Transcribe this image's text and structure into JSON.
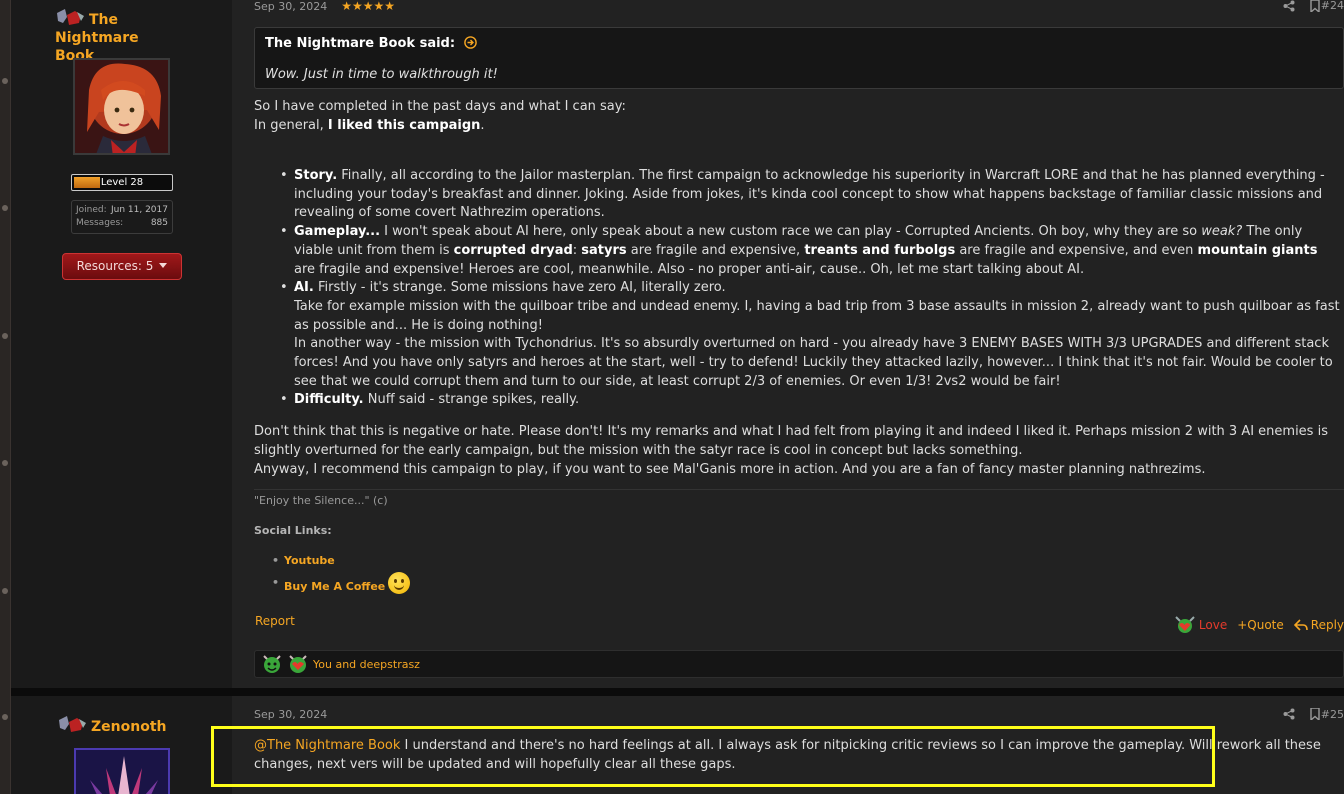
{
  "post1": {
    "author": "The Nightmare Book",
    "author_line1": "The Nightmare",
    "author_line2": "Book",
    "level": "Level 28",
    "joined_label": "Joined:",
    "joined_value": "Jun 11, 2017",
    "messages_label": "Messages:",
    "messages_value": "885",
    "resources_label": "Resources: 5",
    "date": "Sep 30, 2024",
    "rating": "★★★★★",
    "post_number": "#24",
    "quote_header": "The Nightmare Book said:",
    "quote_body": "Wow. Just in time to walkthrough it!",
    "intro_line1": "So I have completed in the past days and what I can say:",
    "intro_line2_pre": "In general, ",
    "intro_line2_bold": "I liked this campaign",
    "intro_line2_post": ".",
    "bullets": {
      "story_title": "Story.",
      "story_text": " Finally, all according to the Jailor masterplan. The first campaign to acknowledge his superiority in Warcraft LORE and that he has planned everything - including your today's breakfast and dinner. Joking. Aside from jokes, it's kinda cool concept to show what happens backstage of familiar classic missions and revealing of some covert Nathrezim operations.",
      "gameplay_title": "Gameplay...",
      "gameplay_text1": " I won't speak about AI here, only speak about a new custom race we can play - Corrupted Ancients. Oh boy, why they are so ",
      "gameplay_weak": "weak?",
      "gameplay_text2": " The only viable unit from them is ",
      "gameplay_dryad": "corrupted dryad",
      "gameplay_colon": ": ",
      "gameplay_satyrs": "satyrs",
      "gameplay_text3": " are fragile and expensive, ",
      "gameplay_treants": "treants and furbolgs",
      "gameplay_text4": " are fragile and expensive, and even ",
      "gameplay_giants": "mountain giants",
      "gameplay_text5": " are fragile and expensive! Heroes are cool, meanwhile. Also - no proper anti-air, cause.. Oh, let me start talking about AI.",
      "ai_title": "AI.",
      "ai_text1": " Firstly - it's strange. Some missions have zero AI, literally zero.",
      "ai_text2": "Take for example mission with the quilboar tribe and undead enemy. I, having a bad trip from 3 base assaults in mission 2, already want to push quilboar as fast as possible and... He is doing nothing!",
      "ai_text3": "In another way - the mission with Tychondrius. It's so absurdly overturned on hard - you already have 3 ENEMY BASES WITH 3/3 UPGRADES and different stack forces! And you have only satyrs and heroes at the start, well - try to defend! Luckily they attacked lazily, however... I think that it's not fair. Would be cooler to see that we could corrupt them and turn to our side, at least corrupt 2/3 of enemies. Or even 1/3! 2vs2 would be fair!",
      "difficulty_title": "Difficulty.",
      "difficulty_text": " Nuff said - strange spikes, really."
    },
    "outro1": "Don't think that this is negative or hate. Please don't! It's my remarks and what I had felt from playing it and indeed I liked it. Perhaps mission 2 with 3 AI enemies is slightly overturned for the early campaign, but the mission with the satyr race is cool in concept but lacks something.",
    "outro2": "Anyway, I recommend this campaign to play, if you want to see Mal'Ganis more in action. And you are a fan of fancy master planning nathrezims.",
    "signature_quote": "\"Enjoy the Silence...\" (c)",
    "social_title": "Social Links:",
    "social_links": [
      "Youtube",
      "Buy Me A Coffee"
    ],
    "report_label": "Report",
    "love_label": "Love",
    "quote_label": "+Quote",
    "reply_label": "Reply",
    "reactions_text": "You and deepstrasz"
  },
  "post2": {
    "author": "Zenonoth",
    "date": "Sep 30, 2024",
    "post_number": "#25",
    "mention": "@The Nightmare Book",
    "text": " I understand and there's no hard feelings at all. I always ask for nitpicking critic reviews so I can improve the gameplay. Will rework all these changes, next vers will be updated and will hopefully clear all these gaps."
  },
  "colors": {
    "accent": "#f5a623",
    "love": "#e53b2c",
    "highlight": "#ffff1a",
    "background": "#222222"
  }
}
